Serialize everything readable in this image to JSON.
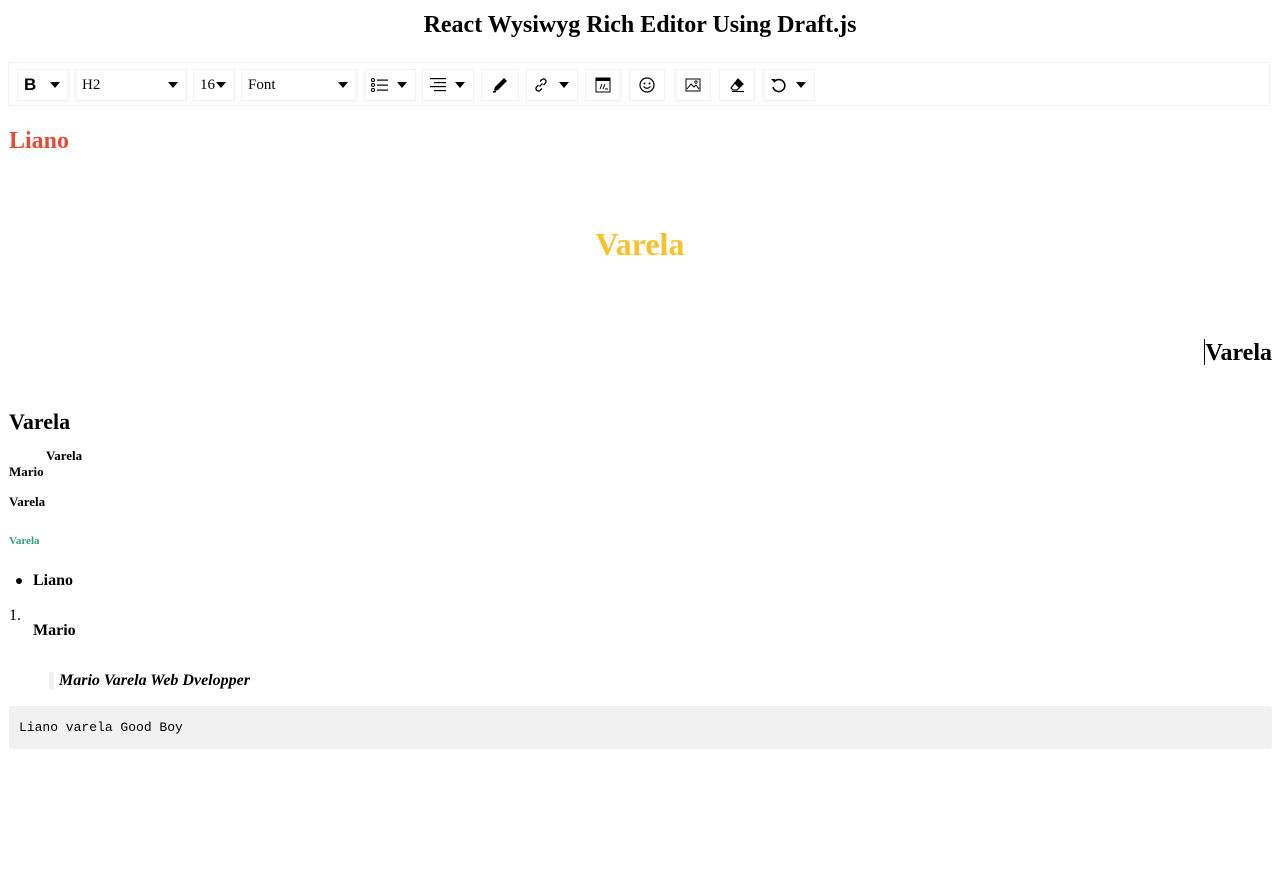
{
  "page": {
    "title": "React Wysiwyg Rich Editor Using Draft.js"
  },
  "toolbar": {
    "inline_label": "B",
    "block_type": "H2",
    "font_size": "16",
    "font_family": "Font"
  },
  "editor": {
    "heading_liano": "Liano",
    "heading_varela_center": "Varela",
    "heading_varela_right": "Varela",
    "heading_varela_left": "Varela",
    "small_varela_indent": "Varela",
    "small_mario": "Mario",
    "small_varela": "Varela",
    "tiny_varela_green": "Varela",
    "bullet_item": "Liano",
    "ordered_number": "1.",
    "ordered_item": "Mario",
    "blockquote": "Mario Varela Web Dvelopper",
    "code": "Liano varela Good Boy"
  },
  "colors": {
    "red": "#e04e39",
    "yellow": "#f9c12d",
    "green": "#2e9e79",
    "toolbar_border": "#f1f1f1",
    "code_bg": "#f1f1f1"
  },
  "icons": [
    "bold-icon",
    "list-icon",
    "align-icon",
    "color-picker-icon",
    "link-icon",
    "embed-icon",
    "emoji-icon",
    "image-icon",
    "eraser-icon",
    "undo-icon"
  ]
}
